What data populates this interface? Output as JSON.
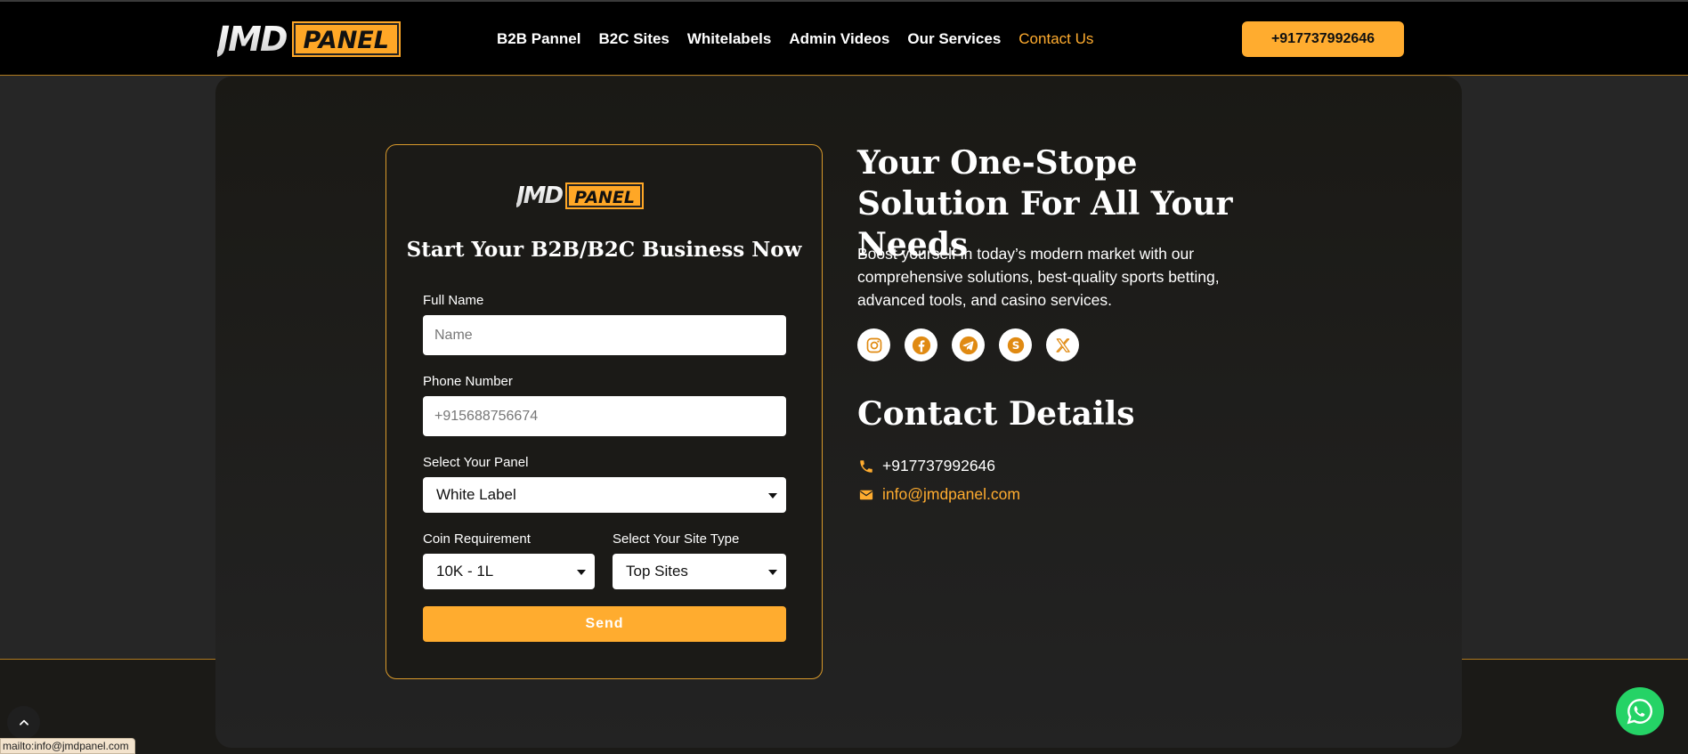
{
  "brand": {
    "logo_word": "JMD",
    "logo_badge": "PANEL"
  },
  "nav": {
    "items": [
      {
        "label": "B2B Pannel",
        "active": false
      },
      {
        "label": "B2C Sites",
        "active": false
      },
      {
        "label": "Whitelabels",
        "active": false
      },
      {
        "label": "Admin Videos",
        "active": false
      },
      {
        "label": "Our Services",
        "active": false
      },
      {
        "label": "Contact Us",
        "active": true
      }
    ],
    "phone_button": "+917737992646"
  },
  "form": {
    "title": "Start Your B2B/B2C Business Now",
    "full_name": {
      "label": "Full Name",
      "placeholder": "Name",
      "value": ""
    },
    "phone": {
      "label": "Phone Number",
      "placeholder": "+915688756674",
      "value": ""
    },
    "panel": {
      "label": "Select Your Panel",
      "selected": "White Label"
    },
    "coin": {
      "label": "Coin Requirement",
      "selected": "10K - 1L"
    },
    "site_type": {
      "label": "Select Your Site Type",
      "selected": "Top Sites"
    },
    "send_label": "Send"
  },
  "hero": {
    "title": "Your One-Stope Solution For All Your Needs",
    "description": "Boost yourself in today’s modern market with our comprehensive solutions, best-quality sports betting, advanced tools, and casino services."
  },
  "socials": [
    {
      "icon": "instagram-icon"
    },
    {
      "icon": "facebook-icon"
    },
    {
      "icon": "telegram-icon"
    },
    {
      "icon": "skype-icon"
    },
    {
      "icon": "x-twitter-icon"
    }
  ],
  "contact": {
    "title": "Contact Details",
    "phone": "+917737992646",
    "email": "info@jmdpanel.com"
  },
  "status_bar": {
    "url": "mailto:info@jmdpanel.com"
  },
  "colors": {
    "accent": "#ffac2f",
    "header_bg": "#000000",
    "page_bg": "#262626",
    "whatsapp": "#25d366"
  }
}
